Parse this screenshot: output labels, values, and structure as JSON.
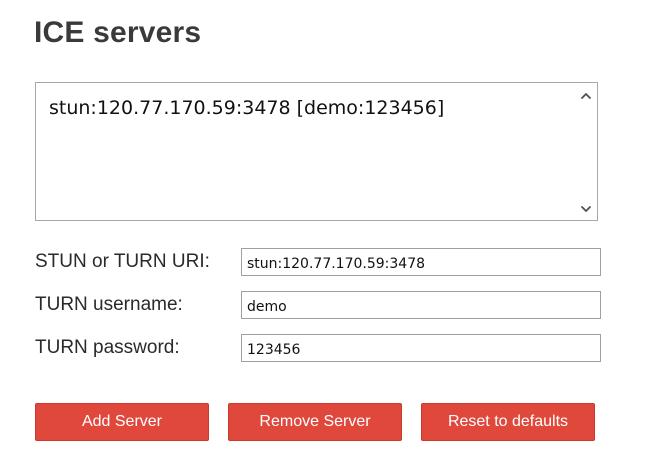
{
  "section": {
    "title": "ICE servers"
  },
  "server_list": {
    "items": [
      "stun:120.77.170.59:3478 [demo:123456]"
    ]
  },
  "form": {
    "uri_label": "STUN or TURN URI:",
    "uri_value": "stun:120.77.170.59:3478",
    "username_label": "TURN username:",
    "username_value": "demo",
    "password_label": "TURN password:",
    "password_value": "123456"
  },
  "buttons": {
    "add": "Add Server",
    "remove": "Remove Server",
    "reset": "Reset to defaults"
  },
  "colors": {
    "button_background": "#e0483c",
    "button_text": "#ffffff"
  },
  "icons": {
    "scroll_up": "chevron-up-icon",
    "scroll_down": "chevron-down-icon"
  }
}
